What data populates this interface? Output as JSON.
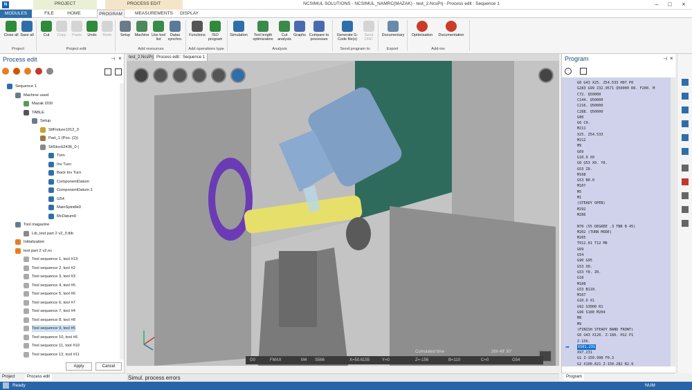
{
  "title_bar": {
    "title": "NCSIMUL SOLUTIONS - NCSIMUL_NAMRC(MAZAK) - test_2.NcsPrj - Process edit : Sequence 1",
    "context_project": "PROJECT",
    "context_process": "PROCESS EDIT"
  },
  "tabs": [
    "MODULES",
    "FILE",
    "HOME",
    "PROGRAM",
    "MEASUREMENTS",
    "DISPLAY"
  ],
  "ribbon": {
    "groups": [
      {
        "name": "Project",
        "buttons": [
          "Close all",
          "Save all"
        ]
      },
      {
        "name": "Project edit",
        "buttons": [
          "Cut",
          "Copy",
          "Paste",
          "Undo",
          "Redo"
        ]
      },
      {
        "name": "Add resources",
        "buttons": [
          "Setup",
          "Machine",
          "Use tool list",
          "Datas synchro."
        ]
      },
      {
        "name": "Add operations type",
        "buttons": [
          "Functions",
          "ISO program"
        ]
      },
      {
        "name": "Analysis",
        "buttons": [
          "Simulation",
          "Tool length optimization",
          "Cut analysis",
          "Graphs",
          "Compare to processes"
        ]
      },
      {
        "name": "Send program to",
        "buttons": [
          "Generate G-Code file(s)",
          "Send DNC"
        ]
      },
      {
        "name": "Export",
        "buttons": [
          "Documentary"
        ]
      },
      {
        "name": "Add-ins",
        "buttons": [
          "Optimisation",
          "Documentation"
        ]
      }
    ]
  },
  "left_panel": {
    "title": "Process edit",
    "tree": [
      "Sequence 1",
      "Machine used",
      "Mazak I200",
      "TABLE",
      "Setup",
      "StlFixture1012_3",
      "Part_1 (Pos. (2))",
      "StlStock2436_0 (",
      "Turn",
      "Inv Turn",
      "Back Inv Turn",
      "ComponentDatum",
      "ComponentDatum 1",
      "G54",
      "MainSpindle0",
      "McDatum0",
      "Tool magazine",
      "Lib_test part 2 v2_0.tlib",
      "Initialization",
      "test part 2 v2.nc",
      "Tool sequence 1, tool #13",
      "Tool sequence 2, tool #2",
      "Tool sequence 3, tool #3",
      "Tool sequence 4, tool #5",
      "Tool sequence 5, tool #6",
      "Tool sequence 6, tool #7",
      "Tool sequence 7, tool #4",
      "Tool sequence 8, tool #8",
      "Tool sequence 9, tool #5",
      "Tool sequence 10, tool #6",
      "Tool sequence 11, tool #10",
      "Tool sequence 12, tool #11"
    ],
    "apply": "Apply",
    "cancel": "Cancel",
    "bottom_tabs": [
      "Project",
      "Process edit"
    ]
  },
  "viewport": {
    "tabs": [
      "test_2.NcsPrj",
      "Process edit : Sequence 1"
    ],
    "cumulated_label": "Cumulated time",
    "cumulated_value": "26h 49' 30\"",
    "status": [
      "G0",
      "FMAX",
      "M4",
      "S566",
      "X=50.6155",
      "Y=0",
      "Z=-156",
      "B=110",
      "C=0",
      "G54"
    ]
  },
  "errors_panel": {
    "title": "Simul. process errors"
  },
  "right_panel": {
    "title": "Program",
    "bottom_tab": "Program",
    "highlight_index": 46,
    "lines": [
      "G0 G43 X25. Z54.533 H07 P0",
      "G283 G99 Z32.9571 Q50000 R0. F200. M",
      "C72. Q50000",
      "C144. Q50000",
      "C216. Q50000",
      "C288. Q50000",
      "G80",
      "G0 C0.",
      "M211",
      "X25. Z54.533",
      "M212",
      "M9",
      "G69",
      "G10.9 X0",
      "G0 G53 X0. Y0.",
      "G53 Z0.",
      "M108",
      "G53 B0.0",
      "M107",
      "M5",
      "M1",
      "(STEADY OPEN)",
      "M292",
      "M286",
      "",
      "N70 (55 DEGREE .3 TNR B 45)",
      "M202 (TURN MODE)",
      "M205",
      "T012.01 T12 M6",
      "G69",
      "G54",
      "G90 G95",
      "G53 X0.",
      "G53 Y0. Z0.",
      "G18",
      "M108",
      "G53 B110.",
      "M107",
      "G10.9 X1",
      "G92 S3000 R1",
      "G96 S180 M204",
      "M8",
      "M9",
      "(FINISH STEADY BAND FRONT)",
      "G0 G43 X120. Z-160. H12 P1",
      "Z-156.",
      "X101.231",
      "X97.231",
      "G1 Z-150.998 F0.3",
      "G2 X100.821 Z-150.282 R2.9",
      "G1 X101.231",
      "G0 X107.231",
      "Z-156."
    ]
  },
  "status_bar": {
    "left": "Ready",
    "right": "NUM"
  },
  "colors": {
    "accent": "#2865a8",
    "code_bg": "#cfd2ea",
    "highlight": "#1673d1"
  }
}
